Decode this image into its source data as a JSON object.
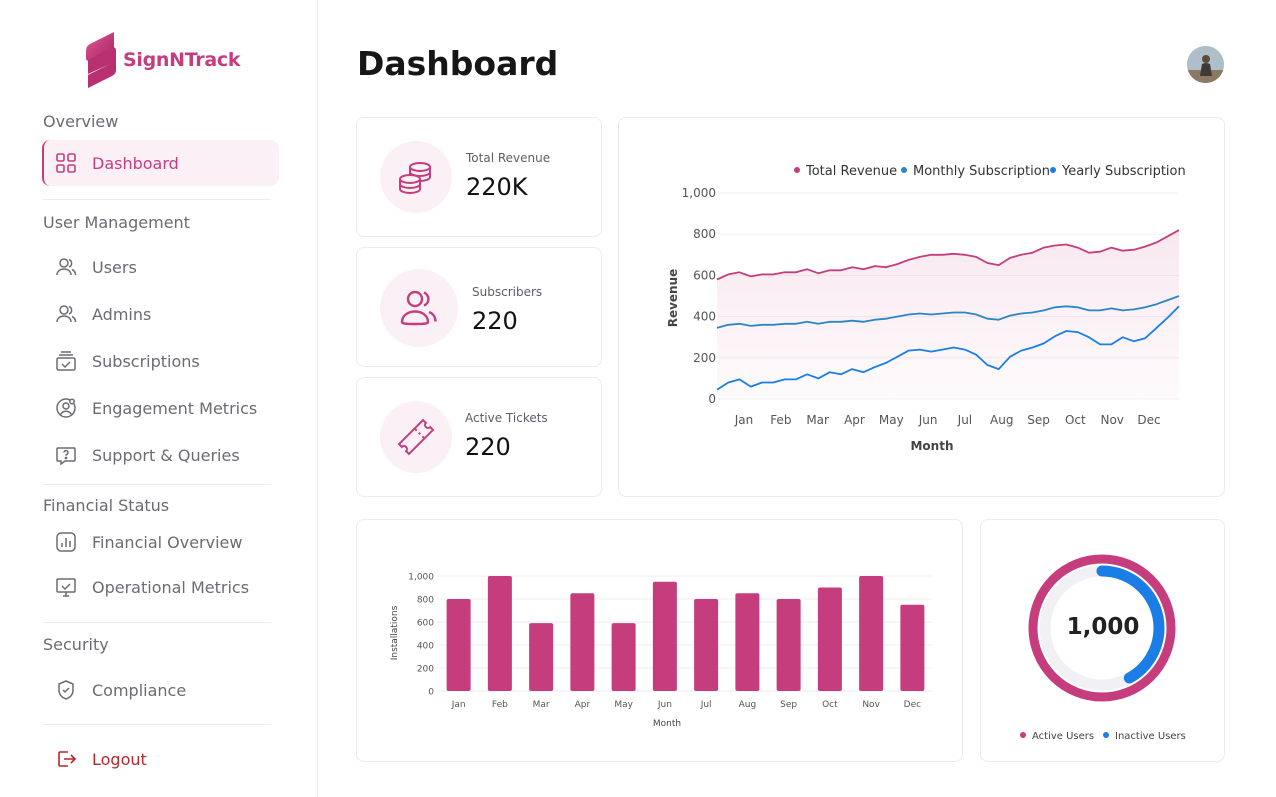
{
  "app": {
    "brand": "SignNTrack",
    "page_title": "Dashboard"
  },
  "colors": {
    "accent": "#c53d7d",
    "monthly": "#2a87c4",
    "yearly": "#1b7ee6",
    "logout": "#b3282d"
  },
  "sidebar": {
    "sections": [
      {
        "title": "Overview"
      },
      {
        "title": "User Management"
      },
      {
        "title": "Financial Status"
      },
      {
        "title": "Security"
      }
    ],
    "items": [
      {
        "label": "Dashboard",
        "icon": "grid-icon",
        "active": true
      },
      {
        "label": "Users",
        "icon": "users-icon"
      },
      {
        "label": "Admins",
        "icon": "admins-icon"
      },
      {
        "label": "Subscriptions",
        "icon": "subscriptions-icon"
      },
      {
        "label": "Engagement Metrics",
        "icon": "engagement-icon"
      },
      {
        "label": "Support & Queries",
        "icon": "support-icon"
      },
      {
        "label": "Financial Overview",
        "icon": "financial-icon"
      },
      {
        "label": "Operational Metrics",
        "icon": "monitor-icon"
      },
      {
        "label": "Compliance",
        "icon": "shield-icon"
      }
    ],
    "logout": {
      "label": "Logout",
      "icon": "logout-icon"
    }
  },
  "stats": [
    {
      "label": "Total Revenue",
      "value": "220K",
      "icon": "coins-icon"
    },
    {
      "label": "Subscribers",
      "value": "220",
      "icon": "users-icon"
    },
    {
      "label": "Active Tickets",
      "value": "220",
      "icon": "ticket-icon"
    }
  ],
  "chart_data": [
    {
      "type": "line",
      "xlabel": "Month",
      "ylabel": "Revenue",
      "ylim": [
        0,
        1000
      ],
      "yticks": [
        "0",
        "200",
        "400",
        "600",
        "800",
        "1,000"
      ],
      "categories": [
        "Jan",
        "Feb",
        "Mar",
        "Apr",
        "May",
        "Jun",
        "Jul",
        "Aug",
        "Sep",
        "Oct",
        "Nov",
        "Dec"
      ],
      "legend_position": "top-right",
      "grid": true,
      "series": [
        {
          "name": "Total Revenue",
          "color": "#c53d7d",
          "values": [
            580,
            605,
            615,
            595,
            605,
            605,
            615,
            615,
            630,
            610,
            625,
            625,
            640,
            630,
            645,
            640,
            655,
            675,
            690,
            700,
            700,
            705,
            700,
            690,
            660,
            650,
            685,
            700,
            710,
            735,
            745,
            750,
            735,
            710,
            715,
            735,
            720,
            725,
            740,
            760,
            790,
            820
          ]
        },
        {
          "name": "Monthly Subscription",
          "color": "#2a87c4",
          "values": [
            345,
            360,
            365,
            355,
            360,
            360,
            365,
            365,
            375,
            365,
            375,
            375,
            380,
            375,
            385,
            390,
            400,
            410,
            415,
            410,
            415,
            420,
            420,
            410,
            390,
            385,
            405,
            415,
            420,
            430,
            445,
            450,
            445,
            430,
            430,
            440,
            430,
            435,
            445,
            460,
            480,
            500
          ]
        },
        {
          "name": "Yearly Subscription",
          "color": "#1b7ee6",
          "values": [
            45,
            80,
            95,
            60,
            80,
            80,
            95,
            95,
            120,
            100,
            130,
            120,
            145,
            130,
            155,
            175,
            205,
            235,
            240,
            230,
            240,
            250,
            240,
            215,
            165,
            145,
            205,
            235,
            250,
            270,
            305,
            330,
            325,
            300,
            265,
            265,
            300,
            280,
            295,
            345,
            395,
            450
          ]
        }
      ]
    },
    {
      "type": "bar",
      "xlabel": "Month",
      "ylabel": "Installations",
      "ylim": [
        0,
        1000
      ],
      "yticks": [
        "0",
        "200",
        "400",
        "600",
        "800",
        "1,000"
      ],
      "categories": [
        "Jan",
        "Feb",
        "Mar",
        "Apr",
        "May",
        "Jun",
        "Jul",
        "Aug",
        "Sep",
        "Oct",
        "Nov",
        "Dec"
      ],
      "values": [
        800,
        1000,
        590,
        850,
        590,
        950,
        800,
        850,
        800,
        900,
        1000,
        750
      ],
      "color": "#c53d7d",
      "grid": true
    },
    {
      "type": "pie",
      "center_label": "1,000",
      "series": [
        {
          "name": "Active Users",
          "color": "#c53d7d",
          "value": 1.0
        },
        {
          "name": "Inactive Users",
          "color": "#1b7ee6",
          "value": 0.42
        }
      ]
    }
  ]
}
